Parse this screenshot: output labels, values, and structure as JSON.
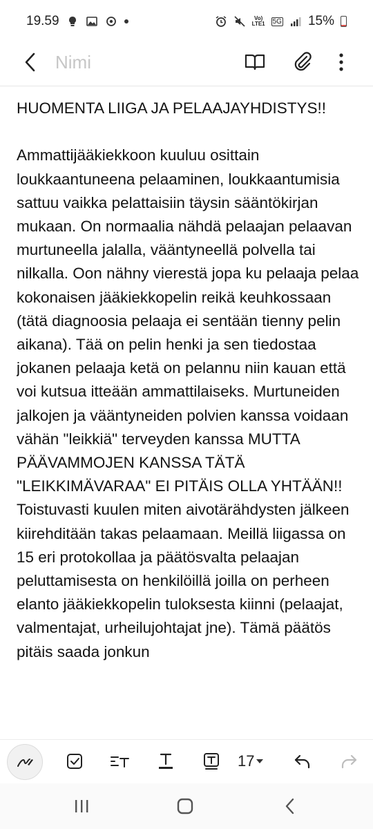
{
  "status_bar": {
    "time": "19.59",
    "net_top": "Vo)",
    "net_bottom": "LTE1",
    "network_5g": "5G",
    "battery": "15%"
  },
  "toolbar": {
    "title_placeholder": "Nimi",
    "title_value": ""
  },
  "note": {
    "text": "HUOMENTA LIIGA JA PELAAJAYHDISTYS!!\n\nAmmattijääkiekkoon kuuluu osittain loukkaantuneena pelaaminen, loukkaantumisia sattuu vaikka pelattaisiin täysin sääntökirjan mukaan. On normaalia nähdä pelaajan pelaavan murtuneella jalalla, vääntyneellä polvella tai nilkalla. Oon nähny vierestä jopa ku pelaaja pelaa kokonaisen jääkiekkopelin reikä keuhkossaan (tätä diagnoosia pelaaja ei sentään tienny pelin aikana). Tää on pelin henki ja sen tiedostaa jokanen pelaaja ketä on pelannu niin kauan että voi kutsua itteään ammattilaiseks. Murtuneiden jalkojen ja vääntyneiden polvien kanssa voidaan vähän \"leikkiä\" terveyden kanssa MUTTA PÄÄVAMMOJEN KANSSA TÄTÄ \"LEIKKIMÄVARAA\" EI PITÄIS OLLA YHTÄÄN!! Toistuvasti kuulen miten aivotärähdysten jälkeen kiirehditään takas pelaamaan. Meillä liigassa on 15 eri protokollaa ja päätösvalta pelaajan peluttamisesta on henkilöillä joilla on perheen elanto jääkiekkopelin tuloksesta kiinni (pelaajat, valmentajat, urheilujohtajat jne). Tämä päätös pitäis saada jonkun"
  },
  "edit_toolbar": {
    "font_size": "17"
  },
  "colors": {
    "placeholder": "#c6c6c6",
    "text": "#141414",
    "icon": "#333333",
    "battery_low": "#d9534f"
  },
  "icons": {
    "back": "chevron-left-icon",
    "reader_mode": "book-icon",
    "attach": "paperclip-icon",
    "more": "more-vertical-icon",
    "pen": "pen-icon",
    "checkbox": "checkbox-icon",
    "paragraph": "paragraph-style-icon",
    "text_color": "text-color-icon",
    "text_box": "text-box-icon",
    "undo": "undo-icon",
    "redo": "redo-icon",
    "recents": "recent-apps-icon",
    "home": "home-icon",
    "nav_back": "nav-back-icon"
  }
}
